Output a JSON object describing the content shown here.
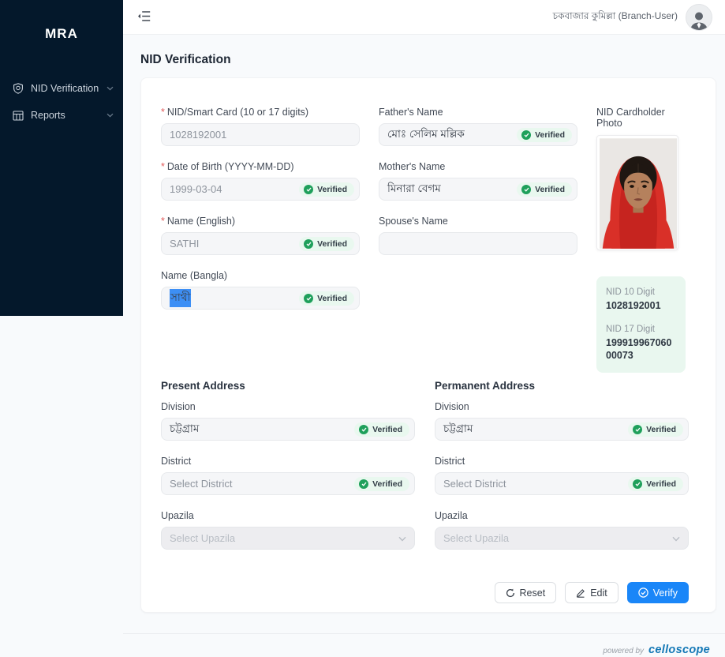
{
  "colors": {
    "sidebar_bg": "#04182b",
    "accent_blue": "#1a86f8",
    "verified_green": "#1fa05b",
    "verified_bg": "#e9f8ef",
    "brand_blue": "#1478b6",
    "selection_blue": "#3d8ff5"
  },
  "labels": {
    "verified": "Verified",
    "required_marker": "*"
  },
  "sidebar": {
    "logo": "MRA",
    "items": [
      {
        "label": "NID Verification",
        "icon": "shield-verified-icon"
      },
      {
        "label": "Reports",
        "icon": "table-icon"
      }
    ]
  },
  "header": {
    "user_name": "চকবাজার কুমিল্লা (Branch-User)"
  },
  "page": {
    "title": "NID Verification"
  },
  "form": {
    "nid": {
      "label": "NID/Smart Card (10 or 17 digits)",
      "value": "1028192001"
    },
    "dob": {
      "label": "Date of Birth (YYYY-MM-DD)",
      "value": "1999-03-04"
    },
    "name_en": {
      "label": "Name (English)",
      "value": "SATHI"
    },
    "name_bn": {
      "label": "Name (Bangla)",
      "value": "সাথী"
    },
    "father": {
      "label": "Father's Name",
      "value": "মোঃ সেলিম মল্লিক"
    },
    "mother": {
      "label": "Mother's Name",
      "value": "মিনারা বেগম"
    },
    "spouse": {
      "label": "Spouse's Name",
      "value": ""
    }
  },
  "photo": {
    "label": "NID Cardholder Photo"
  },
  "nid_summary": {
    "d10_label": "NID 10 Digit",
    "d10_value": "1028192001",
    "d17_label": "NID 17 Digit",
    "d17_value": "19991996706000073"
  },
  "present_address": {
    "title": "Present Address",
    "division_label": "Division",
    "division_value": "চট্টগ্রাম",
    "district_label": "District",
    "district_placeholder": "Select District",
    "upazila_label": "Upazila",
    "upazila_placeholder": "Select Upazila"
  },
  "permanent_address": {
    "title": "Permanent Address",
    "division_label": "Division",
    "division_value": "চট্টগ্রাম",
    "district_label": "District",
    "district_placeholder": "Select District",
    "upazila_label": "Upazila",
    "upazila_placeholder": "Select Upazila"
  },
  "actions": {
    "reset": "Reset",
    "edit": "Edit",
    "verify": "Verify"
  },
  "footer": {
    "powered_by": "powered by",
    "brand": "celloscope"
  }
}
